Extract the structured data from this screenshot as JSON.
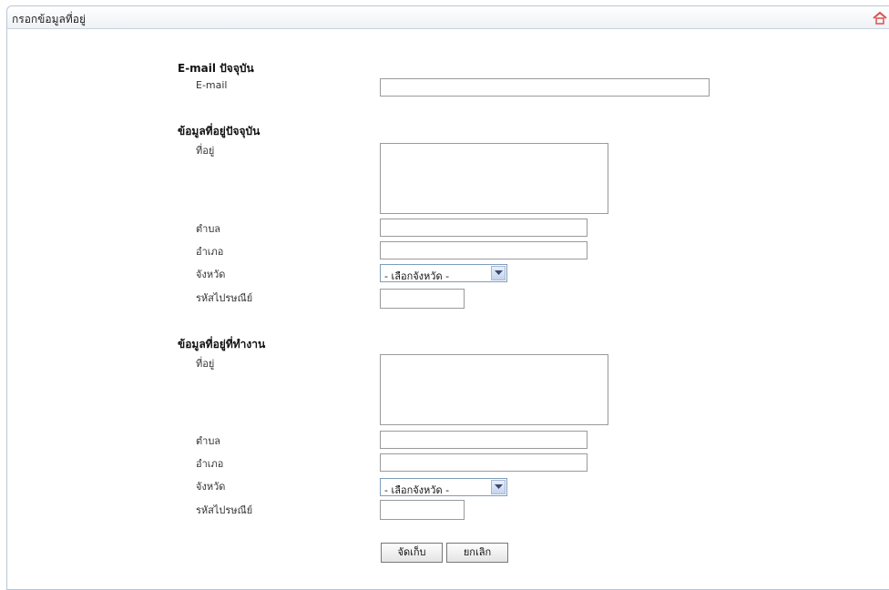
{
  "panel": {
    "title": "กรอกข้อมูลที่อยู่"
  },
  "email_section": {
    "heading": "E-mail ปัจจุบัน",
    "email_label": "E-mail",
    "email_value": ""
  },
  "current_address": {
    "heading": "ข้อมูลที่อยู่ปัจจุบัน",
    "address_label": "ที่อยู่",
    "subdistrict_label": "ตำบล",
    "district_label": "อำเภอ",
    "province_label": "จังหวัด",
    "province_value": "- เลือกจังหวัด -",
    "postcode_label": "รหัสไปรษณีย์"
  },
  "work_address": {
    "heading": "ข้อมูลที่อยู่ที่ทำงาน",
    "address_label": "ที่อยู่",
    "subdistrict_label": "ตำบล",
    "district_label": "อำเภอ",
    "province_label": "จังหวัด",
    "province_value": "- เลือกจังหวัด -",
    "postcode_label": "รหัสไปรษณีย์"
  },
  "buttons": {
    "save_label": "จัดเก็บ",
    "cancel_label": "ยกเลิก"
  },
  "colors": {
    "border": "#b9c6d6",
    "accent_icon": "#d9534f"
  }
}
